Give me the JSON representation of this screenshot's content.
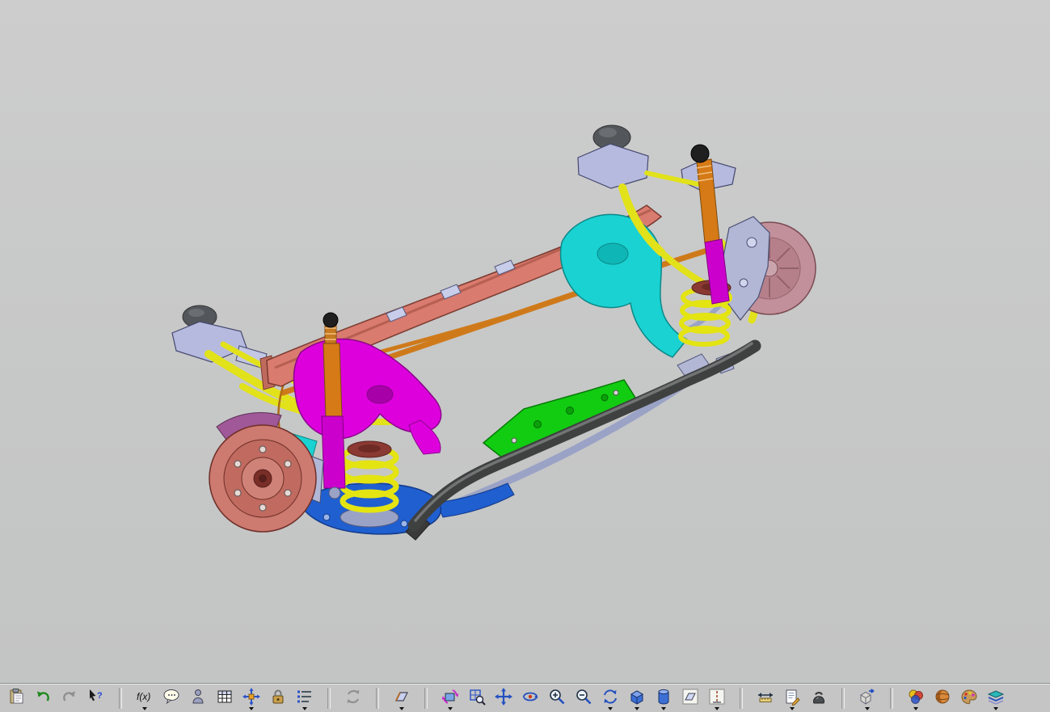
{
  "window": {
    "background": "#c8c8c8",
    "toolbar_background": "#c5c5c5"
  },
  "model": {
    "name": "rear-suspension-assembly",
    "colors": {
      "crossmember_salmon": "#d97b6e",
      "crossmember_edge": "#7a3a30",
      "bracket_magenta": "#dd00dd",
      "shock_tube_magenta": "#cc00cc",
      "strut_orange": "#d57a16",
      "rod_orange": "#cf7a1a",
      "spring_yellow": "#e4e412",
      "arm_yellow": "#e2e21a",
      "carrier_cyan": "#1ad2d2",
      "bracket_green": "#12cc12",
      "stabilizer_gray": "#3f4040",
      "subframe_blue": "#1f5fd0",
      "rail_steel": "#9aa3c6",
      "mount_lavender": "#b6bade",
      "bumper_gray": "#53575b",
      "rotor_salmon": "#cd7a70",
      "rotor_pink": "#c2909a",
      "seat_maroon": "#8a3a32",
      "knuckle_steel": "#b2b7d6",
      "caliper_purple": "#a05898",
      "cap_black": "#1f1f1f"
    }
  },
  "toolbar": {
    "items": [
      {
        "name": "paste",
        "icon": "clipboard-icon"
      },
      {
        "name": "undo",
        "icon": "undo-arrow-icon"
      },
      {
        "name": "redo",
        "icon": "redo-arrow-icon"
      },
      {
        "name": "select-help",
        "icon": "cursor-question-icon"
      },
      {
        "type": "separator"
      },
      {
        "name": "relations",
        "icon": "function-icon",
        "dropdown": true
      },
      {
        "name": "comment",
        "icon": "speech-bubble-icon"
      },
      {
        "name": "mini-figure",
        "icon": "person-icon"
      },
      {
        "name": "family-table",
        "icon": "table-icon"
      },
      {
        "name": "move-component",
        "icon": "move-axes-icon",
        "dropdown": true
      },
      {
        "name": "lock",
        "icon": "lock-icon"
      },
      {
        "name": "feature-list",
        "icon": "item-list-icon",
        "dropdown": true
      },
      {
        "type": "separator"
      },
      {
        "name": "regenerate",
        "icon": "regenerate-icon"
      },
      {
        "type": "separator"
      },
      {
        "name": "datum-plane",
        "icon": "datum-plane-icon",
        "dropdown": true
      },
      {
        "type": "separator"
      },
      {
        "name": "orient-view",
        "icon": "orient-view-icon",
        "dropdown": true
      },
      {
        "name": "refit",
        "icon": "refit-icon"
      },
      {
        "name": "pan",
        "icon": "pan-icon"
      },
      {
        "name": "spin",
        "icon": "spin-icon"
      },
      {
        "name": "zoom-in",
        "icon": "zoom-in-icon"
      },
      {
        "name": "zoom-out",
        "icon": "zoom-out-icon"
      },
      {
        "name": "repaint",
        "icon": "repaint-icon",
        "dropdown": true
      },
      {
        "name": "shaded-display",
        "icon": "shaded-box-icon",
        "dropdown": true
      },
      {
        "name": "display-style",
        "icon": "cylinder-icon",
        "dropdown": true
      },
      {
        "name": "plane-display",
        "icon": "plane-display-icon"
      },
      {
        "name": "axis-display",
        "icon": "axis-display-icon",
        "dropdown": true
      },
      {
        "type": "separator"
      },
      {
        "name": "measure",
        "icon": "measure-icon"
      },
      {
        "name": "note",
        "icon": "note-icon",
        "dropdown": true
      },
      {
        "name": "mass-properties",
        "icon": "mass-icon"
      },
      {
        "type": "separator"
      },
      {
        "name": "assemble-component",
        "icon": "component-box-icon",
        "dropdown": true
      },
      {
        "type": "separator"
      },
      {
        "name": "appearances",
        "icon": "appearances-icon",
        "dropdown": true
      },
      {
        "name": "render",
        "icon": "render-sphere-icon"
      },
      {
        "name": "palette",
        "icon": "palette-icon"
      },
      {
        "name": "layers",
        "icon": "layers-icon",
        "dropdown": true
      }
    ]
  }
}
